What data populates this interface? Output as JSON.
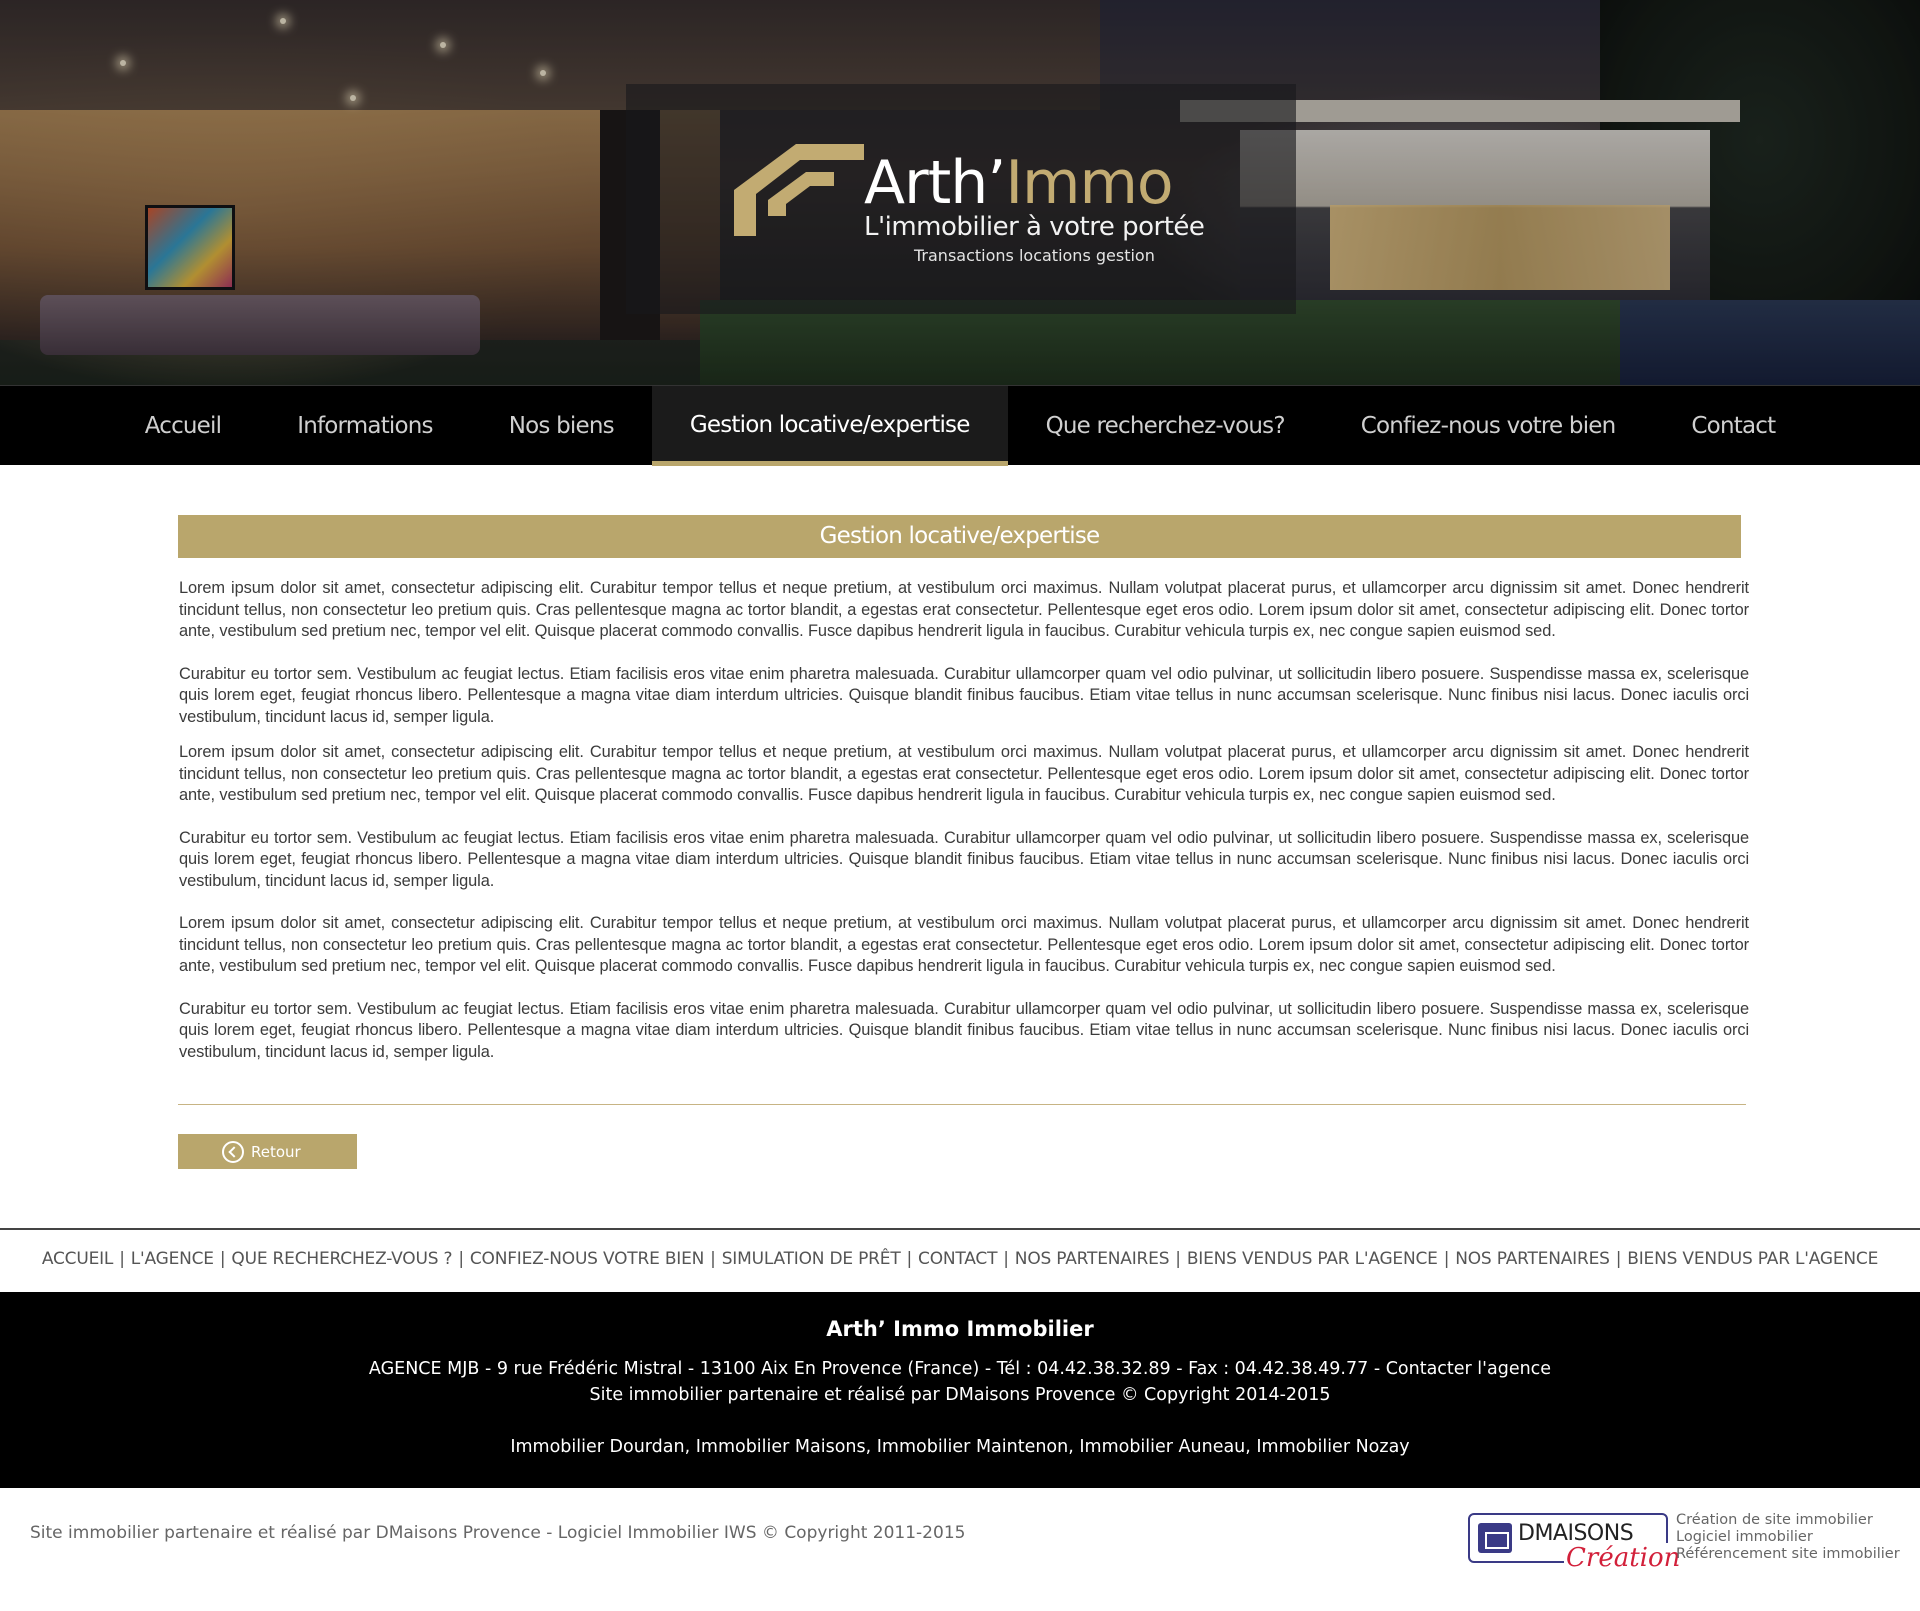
{
  "header": {
    "brand_part1": "Arth’",
    "brand_part2": "Immo",
    "tagline": "L'immobilier à votre portée",
    "subtagline": "Transactions locations gestion"
  },
  "nav": {
    "items": [
      {
        "label": "Accueil",
        "active": false
      },
      {
        "label": "Informations",
        "active": false
      },
      {
        "label": "Nos biens",
        "active": false
      },
      {
        "label": "Gestion locative/expertise",
        "active": true
      },
      {
        "label": "Que recherchez-vous?",
        "active": false
      },
      {
        "label": "Confiez-nous votre bien",
        "active": false
      },
      {
        "label": "Contact",
        "active": false
      }
    ]
  },
  "main": {
    "title": "Gestion locative/expertise",
    "paragraphs": [
      "Lorem ipsum dolor sit amet, consectetur adipiscing elit. Curabitur tempor tellus et neque pretium, at vestibulum orci maximus. Nullam volutpat placerat purus, et ullamcorper arcu dignissim sit amet. Donec hendrerit tincidunt tellus, non consectetur leo pretium quis. Cras pellentesque magna ac tortor blandit, a egestas erat consectetur. Pellentesque eget eros odio. Lorem ipsum dolor sit amet, consectetur adipiscing elit. Donec tortor ante, vestibulum sed pretium nec, tempor vel elit. Quisque placerat commodo convallis. Fusce dapibus hendrerit ligula in faucibus. Curabitur vehicula turpis ex, nec congue sapien euismod sed.",
      "Curabitur eu tortor sem. Vestibulum ac feugiat lectus. Etiam facilisis eros vitae enim pharetra malesuada. Curabitur ullamcorper quam vel odio pulvinar, ut sollicitudin libero posuere. Suspendisse massa ex, scelerisque quis lorem eget, feugiat rhoncus libero. Pellentesque a magna vitae diam interdum ultricies. Quisque blandit finibus faucibus. Etiam vitae tellus in nunc accumsan scelerisque. Nunc finibus nisi lacus. Donec iaculis orci vestibulum, tincidunt lacus id, semper ligula.",
      "Lorem ipsum dolor sit amet, consectetur adipiscing elit. Curabitur tempor tellus et neque pretium, at vestibulum orci maximus. Nullam volutpat placerat purus, et ullamcorper arcu dignissim sit amet. Donec hendrerit tincidunt tellus, non consectetur leo pretium quis. Cras pellentesque magna ac tortor blandit, a egestas erat consectetur. Pellentesque eget eros odio. Lorem ipsum dolor sit amet, consectetur adipiscing elit. Donec tortor ante, vestibulum sed pretium nec, tempor vel elit. Quisque placerat commodo convallis. Fusce dapibus hendrerit ligula in faucibus. Curabitur vehicula turpis ex, nec congue sapien euismod sed.",
      "Curabitur eu tortor sem. Vestibulum ac feugiat lectus. Etiam facilisis eros vitae enim pharetra malesuada. Curabitur ullamcorper quam vel odio pulvinar, ut sollicitudin libero posuere. Suspendisse massa ex, scelerisque quis lorem eget, feugiat rhoncus libero. Pellentesque a magna vitae diam interdum ultricies. Quisque blandit finibus faucibus. Etiam vitae tellus in nunc accumsan scelerisque. Nunc finibus nisi lacus. Donec iaculis orci vestibulum, tincidunt lacus id, semper ligula.",
      "Lorem ipsum dolor sit amet, consectetur adipiscing elit. Curabitur tempor tellus et neque pretium, at vestibulum orci maximus. Nullam volutpat placerat purus, et ullamcorper arcu dignissim sit amet. Donec hendrerit tincidunt tellus, non consectetur leo pretium quis. Cras pellentesque magna ac tortor blandit, a egestas erat consectetur. Pellentesque eget eros odio. Lorem ipsum dolor sit amet, consectetur adipiscing elit. Donec tortor ante, vestibulum sed pretium nec, tempor vel elit. Quisque placerat commodo convallis. Fusce dapibus hendrerit ligula in faucibus. Curabitur vehicula turpis ex, nec congue sapien euismod sed.",
      "Curabitur eu tortor sem. Vestibulum ac feugiat lectus. Etiam facilisis eros vitae enim pharetra malesuada. Curabitur ullamcorper quam vel odio pulvinar, ut sollicitudin libero posuere. Suspendisse massa ex, scelerisque quis lorem eget, feugiat rhoncus libero. Pellentesque a magna vitae diam interdum ultricies. Quisque blandit finibus faucibus. Etiam vitae tellus in nunc accumsan scelerisque. Nunc finibus nisi lacus. Donec iaculis orci vestibulum, tincidunt lacus id, semper ligula."
    ],
    "back_button_label": "Retour",
    "back_icon": "chevron-left-circle-icon"
  },
  "footer_links": {
    "items": [
      "ACCUEIL",
      "L'AGENCE",
      "QUE RECHERCHEZ-VOUS ?",
      "CONFIEZ-NOUS VOTRE BIEN",
      "SIMULATION DE PRÊT",
      "CONTACT",
      "NOS PARTENAIRES",
      "BIENS VENDUS PAR L'AGENCE",
      "NOS PARTENAIRES",
      "BIENS VENDUS PAR L'AGENCE"
    ],
    "separator": "|"
  },
  "footer": {
    "agency_name": "Arth’ Immo Immobilier",
    "address_line": "AGENCE MJB - 9 rue Frédéric Mistral - 13100 Aix En Provence (France) - Tél : 04.42.38.32.89 - Fax : 04.42.38.49.77 - Contacter l'agence",
    "copyright_line": "Site immobilier partenaire et réalisé par DMaisons Provence © Copyright 2014-2015",
    "cities_line": "Immobilier Dourdan, Immobilier Maisons, Immobilier Maintenon, Immobilier Auneau, Immobilier Nozay"
  },
  "bottom_bar": {
    "credit": "Site immobilier partenaire et réalisé par DMaisons Provence - Logiciel Immobilier IWS © Copyright 2011-2015",
    "dm_logo_text": "DMAISONS",
    "dm_logo_script": "Création",
    "dm_lines": [
      "Création de site immobilier",
      "Logiciel immobilier",
      "Référencement site immobilier"
    ]
  },
  "colors": {
    "accent_gold": "#b9a66c",
    "nav_bg": "#000000",
    "footer_bg": "#000000"
  }
}
